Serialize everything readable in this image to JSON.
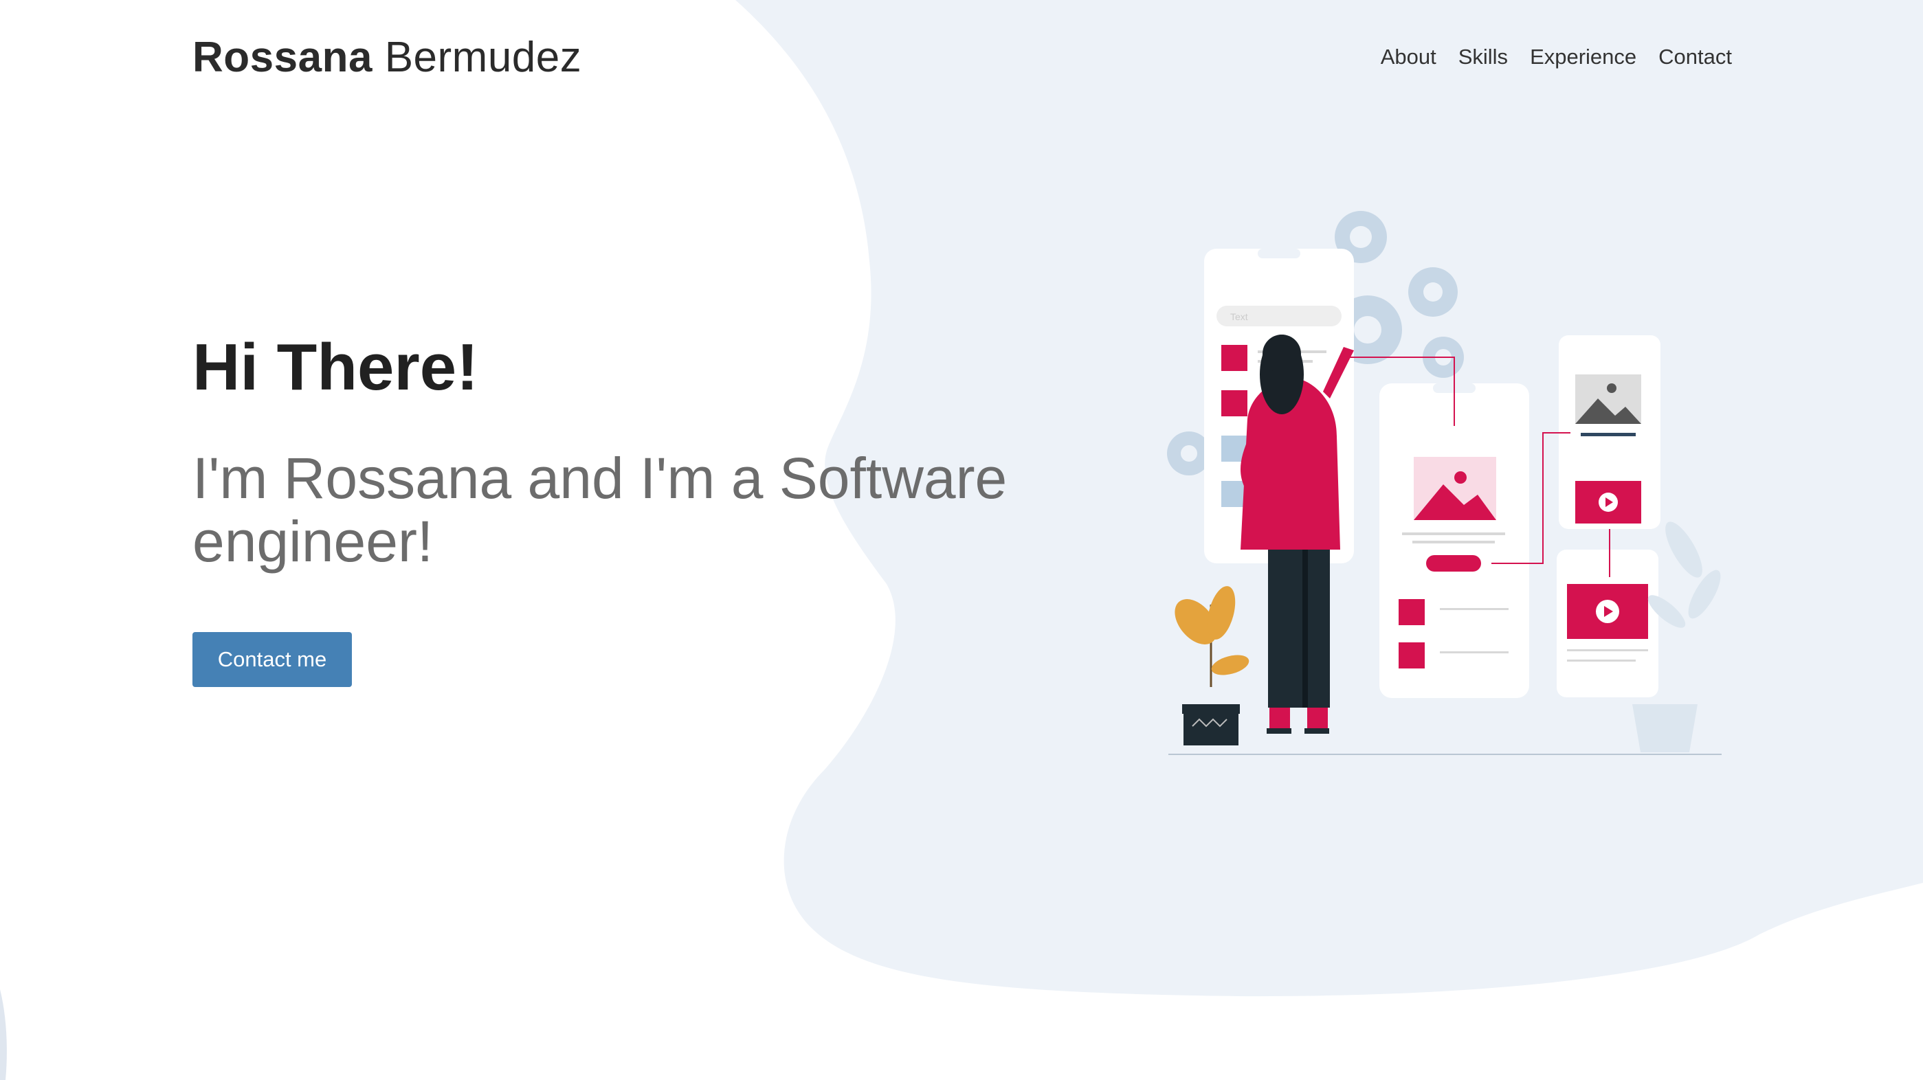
{
  "brand": {
    "first_name": "Rossana",
    "last_name": "Bermudez"
  },
  "nav": {
    "items": [
      {
        "label": "About"
      },
      {
        "label": "Skills"
      },
      {
        "label": "Experience"
      },
      {
        "label": "Contact"
      }
    ]
  },
  "hero": {
    "greeting": "Hi There!",
    "subtitle": "I'm Rossana and I'm a Software engineer!",
    "cta_label": "Contact me"
  },
  "illustration": {
    "search_placeholder": "Text"
  },
  "colors": {
    "accent": "#4581b5",
    "brand_pink": "#d4124f",
    "blob": "#edf2f8",
    "heading": "#212121",
    "subtitle": "#6c6c6c"
  }
}
